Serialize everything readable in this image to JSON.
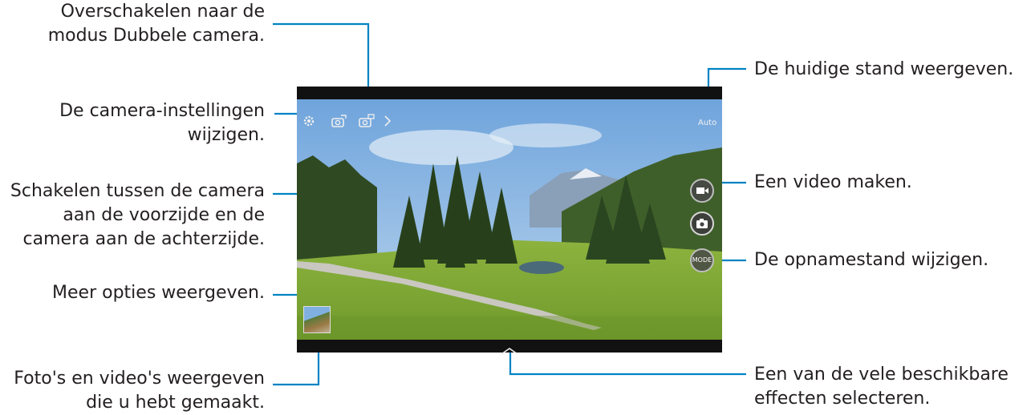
{
  "annotations_left": {
    "dual_camera": [
      "Overschakelen naar de",
      "modus Dubbele camera."
    ],
    "settings": [
      "De camera-instellingen",
      "wijzigen."
    ],
    "switch_camera": [
      "Schakelen tussen de camera",
      "aan de voorzijde en de",
      "camera aan de achterzijde."
    ],
    "more_options": [
      "Meer opties weergeven."
    ],
    "gallery": [
      "Foto's en video's weergeven",
      "die u hebt gemaakt."
    ]
  },
  "annotations_right": {
    "current_mode": [
      "De huidige stand weergeven."
    ],
    "record_video": [
      "Een video maken."
    ],
    "change_mode": [
      "De opnamestand wijzigen."
    ],
    "effects": [
      "Een van de vele beschikbare",
      "effecten selecteren."
    ]
  },
  "camera_ui": {
    "mode_label": "Auto",
    "mode_button_label": "MODE",
    "icons": {
      "settings": "gear-icon",
      "switch_camera": "switch-camera-icon",
      "dual_camera": "dual-camera-icon",
      "more": "chevron-right-icon",
      "video": "video-camera-icon",
      "shutter": "camera-icon",
      "effects": "chevron-up-icon"
    }
  },
  "colors": {
    "callout_line": "#0083c3",
    "text": "#231f20",
    "device_frame": "#111111"
  }
}
